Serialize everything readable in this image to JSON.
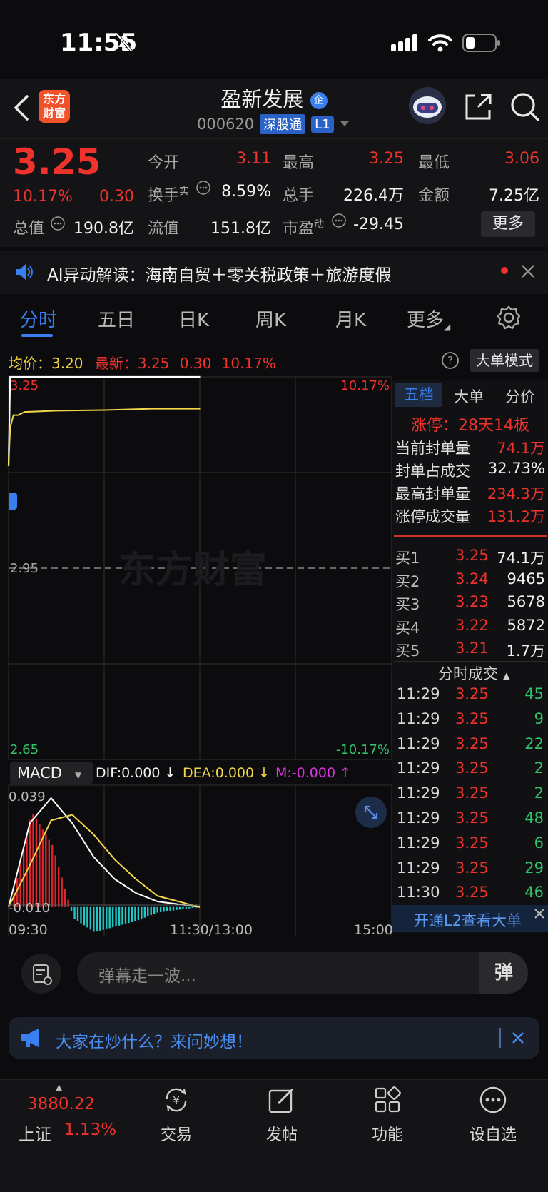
{
  "status_bar": {
    "time": "11:55"
  },
  "header": {
    "stock_name": "盈新发展",
    "name_badge": "企",
    "stock_code": "000620",
    "market_tag": "深股通",
    "level_tag": "L1",
    "logo_line1": "东方",
    "logo_line2": "财富"
  },
  "quote": {
    "price": "3.25",
    "change_pct": "10.17%",
    "change_amt": "0.30",
    "open_label": "今开",
    "open_value": "3.11",
    "high_label": "最高",
    "high_value": "3.25",
    "low_label": "最低",
    "low_value": "3.06",
    "turnover_label": "换手",
    "turnover_sup": "实",
    "turnover_value": "8.59%",
    "volume_label": "总手",
    "volume_value": "226.4万",
    "amount_label": "金额",
    "amount_value": "7.25亿",
    "mktcap_label": "总值",
    "mktcap_value": "190.8亿",
    "float_label": "流值",
    "float_value": "151.8亿",
    "pe_label": "市盈",
    "pe_sup": "动",
    "pe_value": "-29.45",
    "more_button": "更多"
  },
  "ai_banner": {
    "text": "AI异动解读：海南自贸＋零关税政策＋旅游度假"
  },
  "tabs": [
    "分时",
    "五日",
    "日K",
    "周K",
    "月K",
    "更多"
  ],
  "legend": {
    "avg_label": "均价：",
    "avg_value": "3.20",
    "latest_label": "最新：",
    "latest_value": "3.25",
    "latest_change": "0.30",
    "latest_pct": "10.17%",
    "mode_button": "大单模式"
  },
  "chart_labels": {
    "price_top": "3.25",
    "price_mid": "2.95",
    "price_bottom": "2.65",
    "pct_top": "10.17%",
    "pct_bottom": "-10.17%",
    "macd_select": "MACD",
    "dif": "DIF:0.000 ↓",
    "dea": "DEA:0.000 ↓",
    "m": "M:-0.000 ↑",
    "macd_top": "0.039",
    "macd_bottom": "-0.010",
    "time_start": "09:30",
    "time_mid": "11:30/13:00",
    "time_end": "15:00",
    "watermark": "东方财富"
  },
  "chart_data": [
    {
      "type": "line",
      "title": "分时",
      "x": [
        "09:30",
        "09:31",
        "09:33",
        "09:36",
        "09:40",
        "09:50",
        "10:00",
        "10:30",
        "11:00",
        "11:30"
      ],
      "series": [
        {
          "name": "最新",
          "values": [
            3.11,
            3.25,
            3.25,
            3.25,
            3.25,
            3.25,
            3.25,
            3.25,
            3.25,
            3.25
          ]
        },
        {
          "name": "均价",
          "values": [
            3.11,
            3.17,
            3.19,
            3.19,
            3.195,
            3.196,
            3.197,
            3.198,
            3.2,
            3.2
          ]
        }
      ],
      "ylim": [
        2.65,
        3.25
      ],
      "reference": 2.95
    },
    {
      "type": "bar",
      "title": "MACD",
      "ylim": [
        -0.01,
        0.039
      ],
      "series": [
        {
          "name": "DIF",
          "values": [
            0.0,
            0.03,
            0.039,
            0.03,
            0.018,
            0.01,
            0.005,
            0.002,
            0.001,
            0.0
          ]
        },
        {
          "name": "DEA",
          "values": [
            0.0,
            0.015,
            0.031,
            0.033,
            0.026,
            0.017,
            0.01,
            0.004,
            0.002,
            0.0
          ]
        },
        {
          "name": "M",
          "values": [
            0.0,
            0.034,
            0.022,
            -0.004,
            -0.009,
            -0.007,
            -0.005,
            -0.002,
            -0.001,
            0.0
          ]
        }
      ]
    }
  ],
  "side_panel": {
    "tabs": [
      "五档",
      "大单",
      "分价"
    ],
    "limit_up": "涨停：28天14板",
    "stats": [
      {
        "label": "当前封单量",
        "value": "74.1万",
        "color": "red"
      },
      {
        "label": "封单占成交",
        "value": "32.73%",
        "color": "white"
      },
      {
        "label": "最高封单量",
        "value": "234.3万",
        "color": "red"
      },
      {
        "label": "涨停成交量",
        "value": "131.2万",
        "color": "red"
      }
    ],
    "bids": [
      {
        "label": "买1",
        "price": "3.25",
        "vol": "74.1万"
      },
      {
        "label": "买2",
        "price": "3.24",
        "vol": "9465"
      },
      {
        "label": "买3",
        "price": "3.23",
        "vol": "5678"
      },
      {
        "label": "买4",
        "price": "3.22",
        "vol": "5872"
      },
      {
        "label": "买5",
        "price": "3.21",
        "vol": "1.7万"
      }
    ],
    "trades_title": "分时成交",
    "trades": [
      {
        "time": "11:29",
        "price": "3.25",
        "vol": "45"
      },
      {
        "time": "11:29",
        "price": "3.25",
        "vol": "9"
      },
      {
        "time": "11:29",
        "price": "3.25",
        "vol": "22"
      },
      {
        "time": "11:29",
        "price": "3.25",
        "vol": "2"
      },
      {
        "time": "11:29",
        "price": "3.25",
        "vol": "2"
      },
      {
        "time": "11:29",
        "price": "3.25",
        "vol": "48"
      },
      {
        "time": "11:29",
        "price": "3.25",
        "vol": "6"
      },
      {
        "time": "11:29",
        "price": "3.25",
        "vol": "29"
      },
      {
        "time": "11:30",
        "price": "3.25",
        "vol": "46"
      }
    ],
    "l2_banner": "开通L2查看大单"
  },
  "comment": {
    "placeholder": "弹幕走一波...",
    "danmu_icon": "弹"
  },
  "ask_banner": {
    "text": "大家在炒什么？来问妙想！"
  },
  "bottom_nav": {
    "index_value": "3880.22",
    "index_name": "上证",
    "index_pct": "1.13%",
    "items": [
      "交易",
      "发帖",
      "功能",
      "设自选"
    ]
  },
  "colors": {
    "up": "#f0322d",
    "down": "#2fc46a",
    "accent": "#3a7ff0",
    "avg": "#f2d64b",
    "macd_neg": "#22c7c7"
  }
}
